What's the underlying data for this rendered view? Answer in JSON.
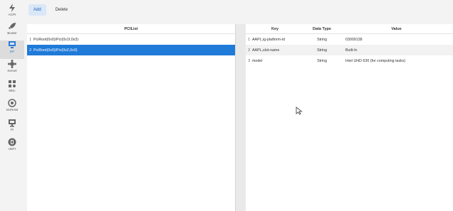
{
  "sidebar": {
    "items": [
      {
        "label": "ACPI",
        "icon": "lightning-icon"
      },
      {
        "label": "Booter",
        "icon": "rocket-icon"
      },
      {
        "label": "DP",
        "icon": "display-icon"
      },
      {
        "label": "Kernel",
        "icon": "kernel-icon"
      },
      {
        "label": "Misc",
        "icon": "misc-icon"
      },
      {
        "label": "NVRAM",
        "icon": "nvram-icon"
      },
      {
        "label": "PI",
        "icon": "platforminfo-icon"
      },
      {
        "label": "UEFI",
        "icon": "uefi-icon"
      }
    ]
  },
  "toolbar": {
    "add_label": "Add",
    "delete_label": "Delete"
  },
  "pci_panel": {
    "header": "PCIList",
    "rows": [
      {
        "index": "1",
        "path": "PciRoot(0x0)/Pci(0x1f,0x3)"
      },
      {
        "index": "2",
        "path": "PciRoot(0x0)/Pci(0x2,0x0)"
      }
    ]
  },
  "props_panel": {
    "headers": {
      "key": "Key",
      "type": "Data Type",
      "value": "Value"
    },
    "rows": [
      {
        "index": "1",
        "key": "AAPL,ig-platform-id",
        "type": "String",
        "value": "03009138"
      },
      {
        "index": "2",
        "key": "AAPL,slot-name",
        "type": "String",
        "value": "Built-In"
      },
      {
        "index": "3",
        "key": "model",
        "type": "String",
        "value": "Intel UHD 630 (for computing tasks)"
      }
    ]
  },
  "colors": {
    "accent": "#1f7ad8",
    "sidebar_active_label": "#2d7bd6"
  }
}
